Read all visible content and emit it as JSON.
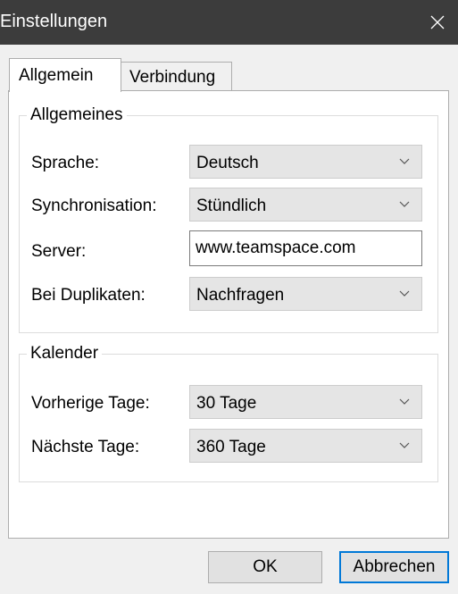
{
  "window": {
    "title": "Einstellungen",
    "close_icon": "close-icon"
  },
  "tabs": [
    {
      "label": "Allgemein",
      "active": true
    },
    {
      "label": "Verbindung",
      "active": false
    }
  ],
  "general": {
    "legend": "Allgemeines",
    "fields": {
      "language": {
        "label": "Sprache:",
        "value": "Deutsch"
      },
      "sync": {
        "label": "Synchronisation:",
        "value": "Stündlich"
      },
      "server": {
        "label": "Server:",
        "value": "www.teamspace.com"
      },
      "duplicates": {
        "label": "Bei Duplikaten:",
        "value": "Nachfragen"
      }
    }
  },
  "calendar": {
    "legend": "Kalender",
    "fields": {
      "previous": {
        "label": "Vorherige Tage:",
        "value": "30 Tage"
      },
      "next": {
        "label": "Nächste Tage:",
        "value": "360 Tage"
      }
    }
  },
  "buttons": {
    "ok": "OK",
    "cancel": "Abbrechen"
  },
  "colors": {
    "titlebar": "#3c3c3c",
    "dialog_bg": "#f0f0f0",
    "panel_bg": "#ffffff",
    "combo_bg": "#e5e5e5",
    "default_button_border": "#0078d7"
  }
}
